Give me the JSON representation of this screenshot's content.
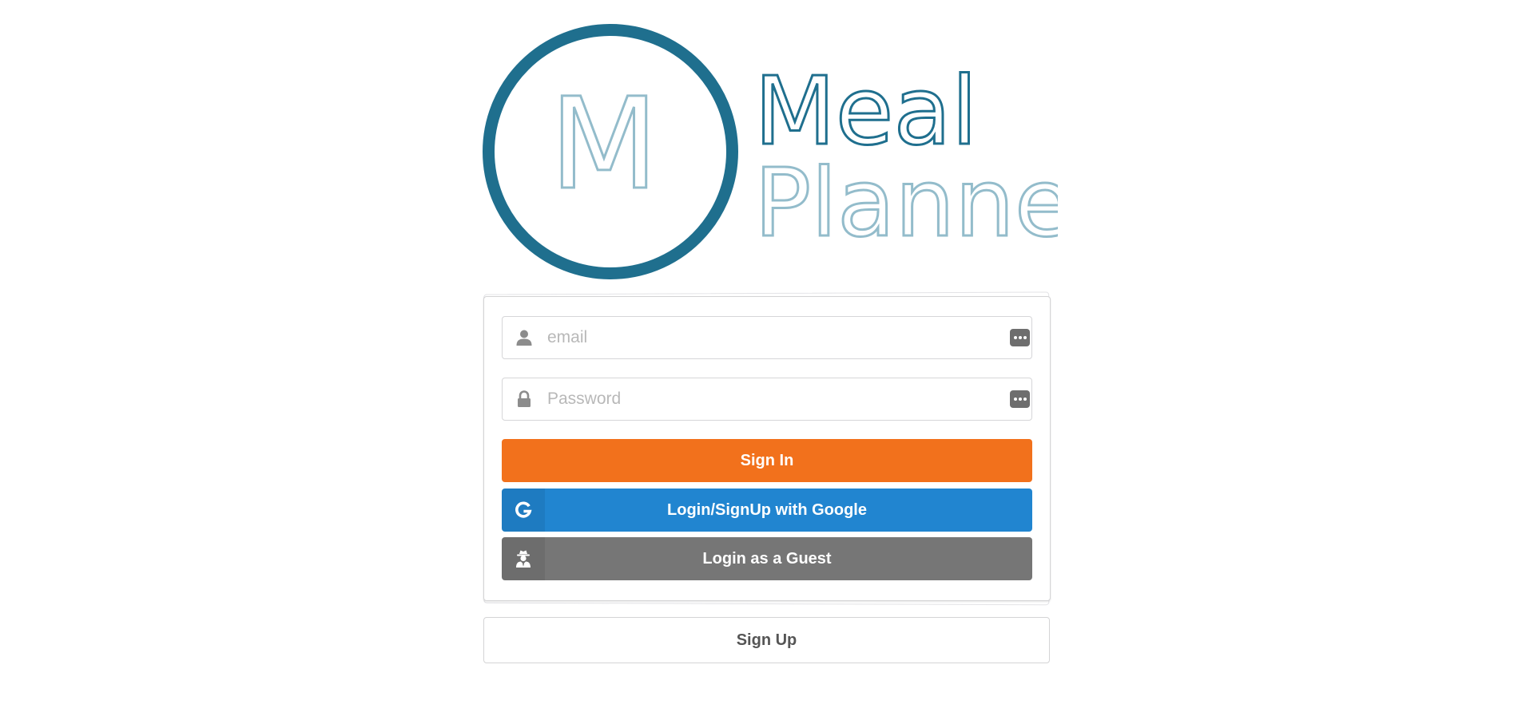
{
  "logo": {
    "monogram": "M",
    "word1": "Meal",
    "word2": "Planner",
    "colors": {
      "dark": "#1f6f8e",
      "light": "#93bccb"
    }
  },
  "login": {
    "email": {
      "value": "",
      "placeholder": "email",
      "icon": "user-icon"
    },
    "password": {
      "value": "",
      "placeholder": "Password",
      "icon": "lock-icon"
    },
    "sign_in_label": "Sign In",
    "google_label": "Login/SignUp with Google",
    "guest_label": "Login as a Guest",
    "colors": {
      "sign_in": "#f2711c",
      "google": "#2185d0",
      "guest": "#767676"
    }
  },
  "signup": {
    "label": "Sign Up"
  }
}
